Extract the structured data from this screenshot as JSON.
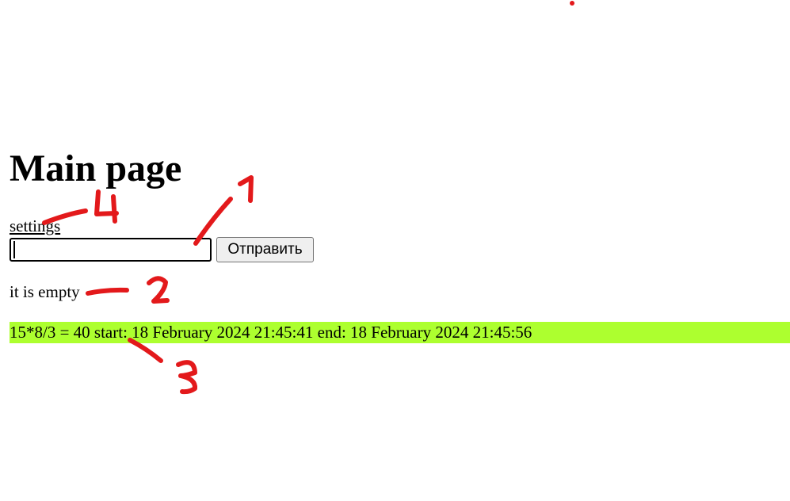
{
  "page": {
    "title": "Main page"
  },
  "nav": {
    "settings_link": "settings"
  },
  "form": {
    "input_value": "",
    "submit_label": "Отправить"
  },
  "status": {
    "text": "it is empty"
  },
  "result": {
    "text": "15*8/3 = 40 start: 18 February 2024 21:45:41 end: 18 February 2024 21:45:56",
    "background": "#adff2f"
  },
  "annotations": {
    "color": "#e3191b",
    "labels": [
      "1",
      "2",
      "3",
      "4"
    ]
  }
}
